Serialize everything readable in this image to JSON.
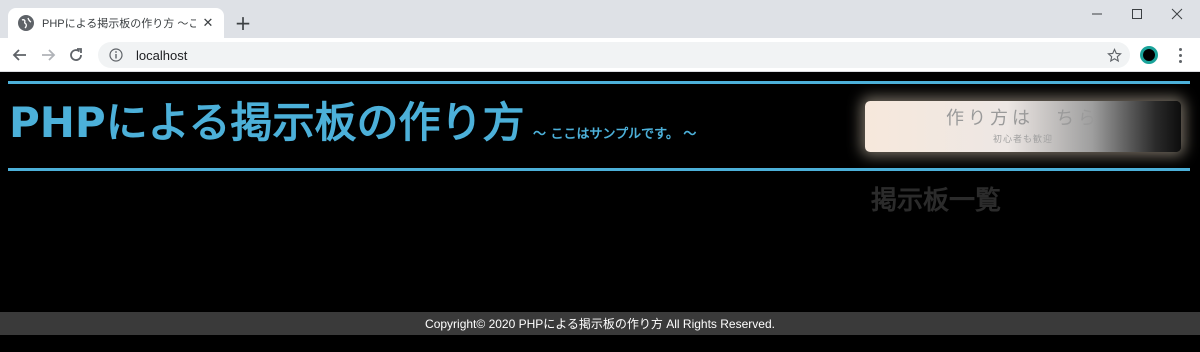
{
  "browser": {
    "tab_title": "PHPによる掲示板の作り方 ～ここはサ",
    "tab_close": "✕",
    "new_tab": "+",
    "url": "localhost",
    "window_controls": {
      "minimize": "minimize-icon",
      "maximize": "maximize-icon",
      "close": "close-icon"
    },
    "accent_profile_color": "#1aa39a"
  },
  "header": {
    "title": "PHPによる掲示板の作り方",
    "subtitle": "～ ここはサンプルです。 ～",
    "accent_color": "#4cb0d9"
  },
  "howto_button": {
    "label": "作り方は　ちら",
    "sublabel": "初心者も歓迎"
  },
  "board": {
    "heading": "掲示板一覧"
  },
  "footer": {
    "copyright": "Copyright© 2020 PHPによる掲示板の作り方 All Rights Reserved."
  }
}
